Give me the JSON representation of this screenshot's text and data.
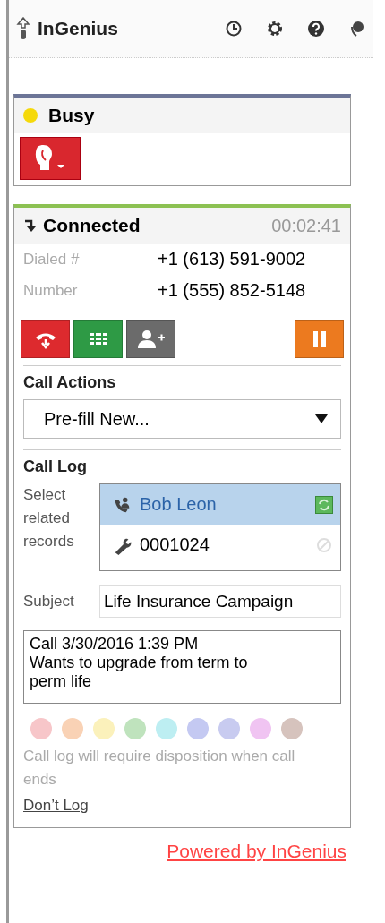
{
  "header": {
    "title": "InGenius"
  },
  "status": {
    "label": "Busy",
    "color": "#f5d90a"
  },
  "call": {
    "state": "Connected",
    "timer": "00:02:41",
    "details": [
      {
        "label": "Dialed #",
        "value": "+1 (613) 591-9002"
      },
      {
        "label": "Number",
        "value": "+1 (555) 852-5148"
      }
    ]
  },
  "call_actions": {
    "title": "Call Actions",
    "value": "Pre-fill New..."
  },
  "call_log": {
    "title": "Call Log",
    "related_label": "Select related records",
    "records": [
      {
        "kind": "contact",
        "label": "Bob Leon",
        "selected": true
      },
      {
        "kind": "case",
        "label": "0001024",
        "selected": false
      }
    ],
    "subject_label": "Subject",
    "subject": "Life Insurance Campaign",
    "notes": "Call 3/30/2016 1:39 PM\nWants to upgrade from term to perm life",
    "dispositions": [
      {
        "color": "#f7c6c9"
      },
      {
        "color": "#f9d2b5"
      },
      {
        "color": "#fbf1bb"
      },
      {
        "color": "#bfe3bd"
      },
      {
        "color": "#bdeef2"
      },
      {
        "color": "#c4c9f2"
      },
      {
        "color": "#c8cbf0"
      },
      {
        "color": "#f0c4f2"
      },
      {
        "color": "#d6c3bd"
      }
    ],
    "hint": "Call log will require disposition when call ends",
    "dont_log": "Don’t Log"
  },
  "footer": {
    "link": "Powered by InGenius"
  }
}
